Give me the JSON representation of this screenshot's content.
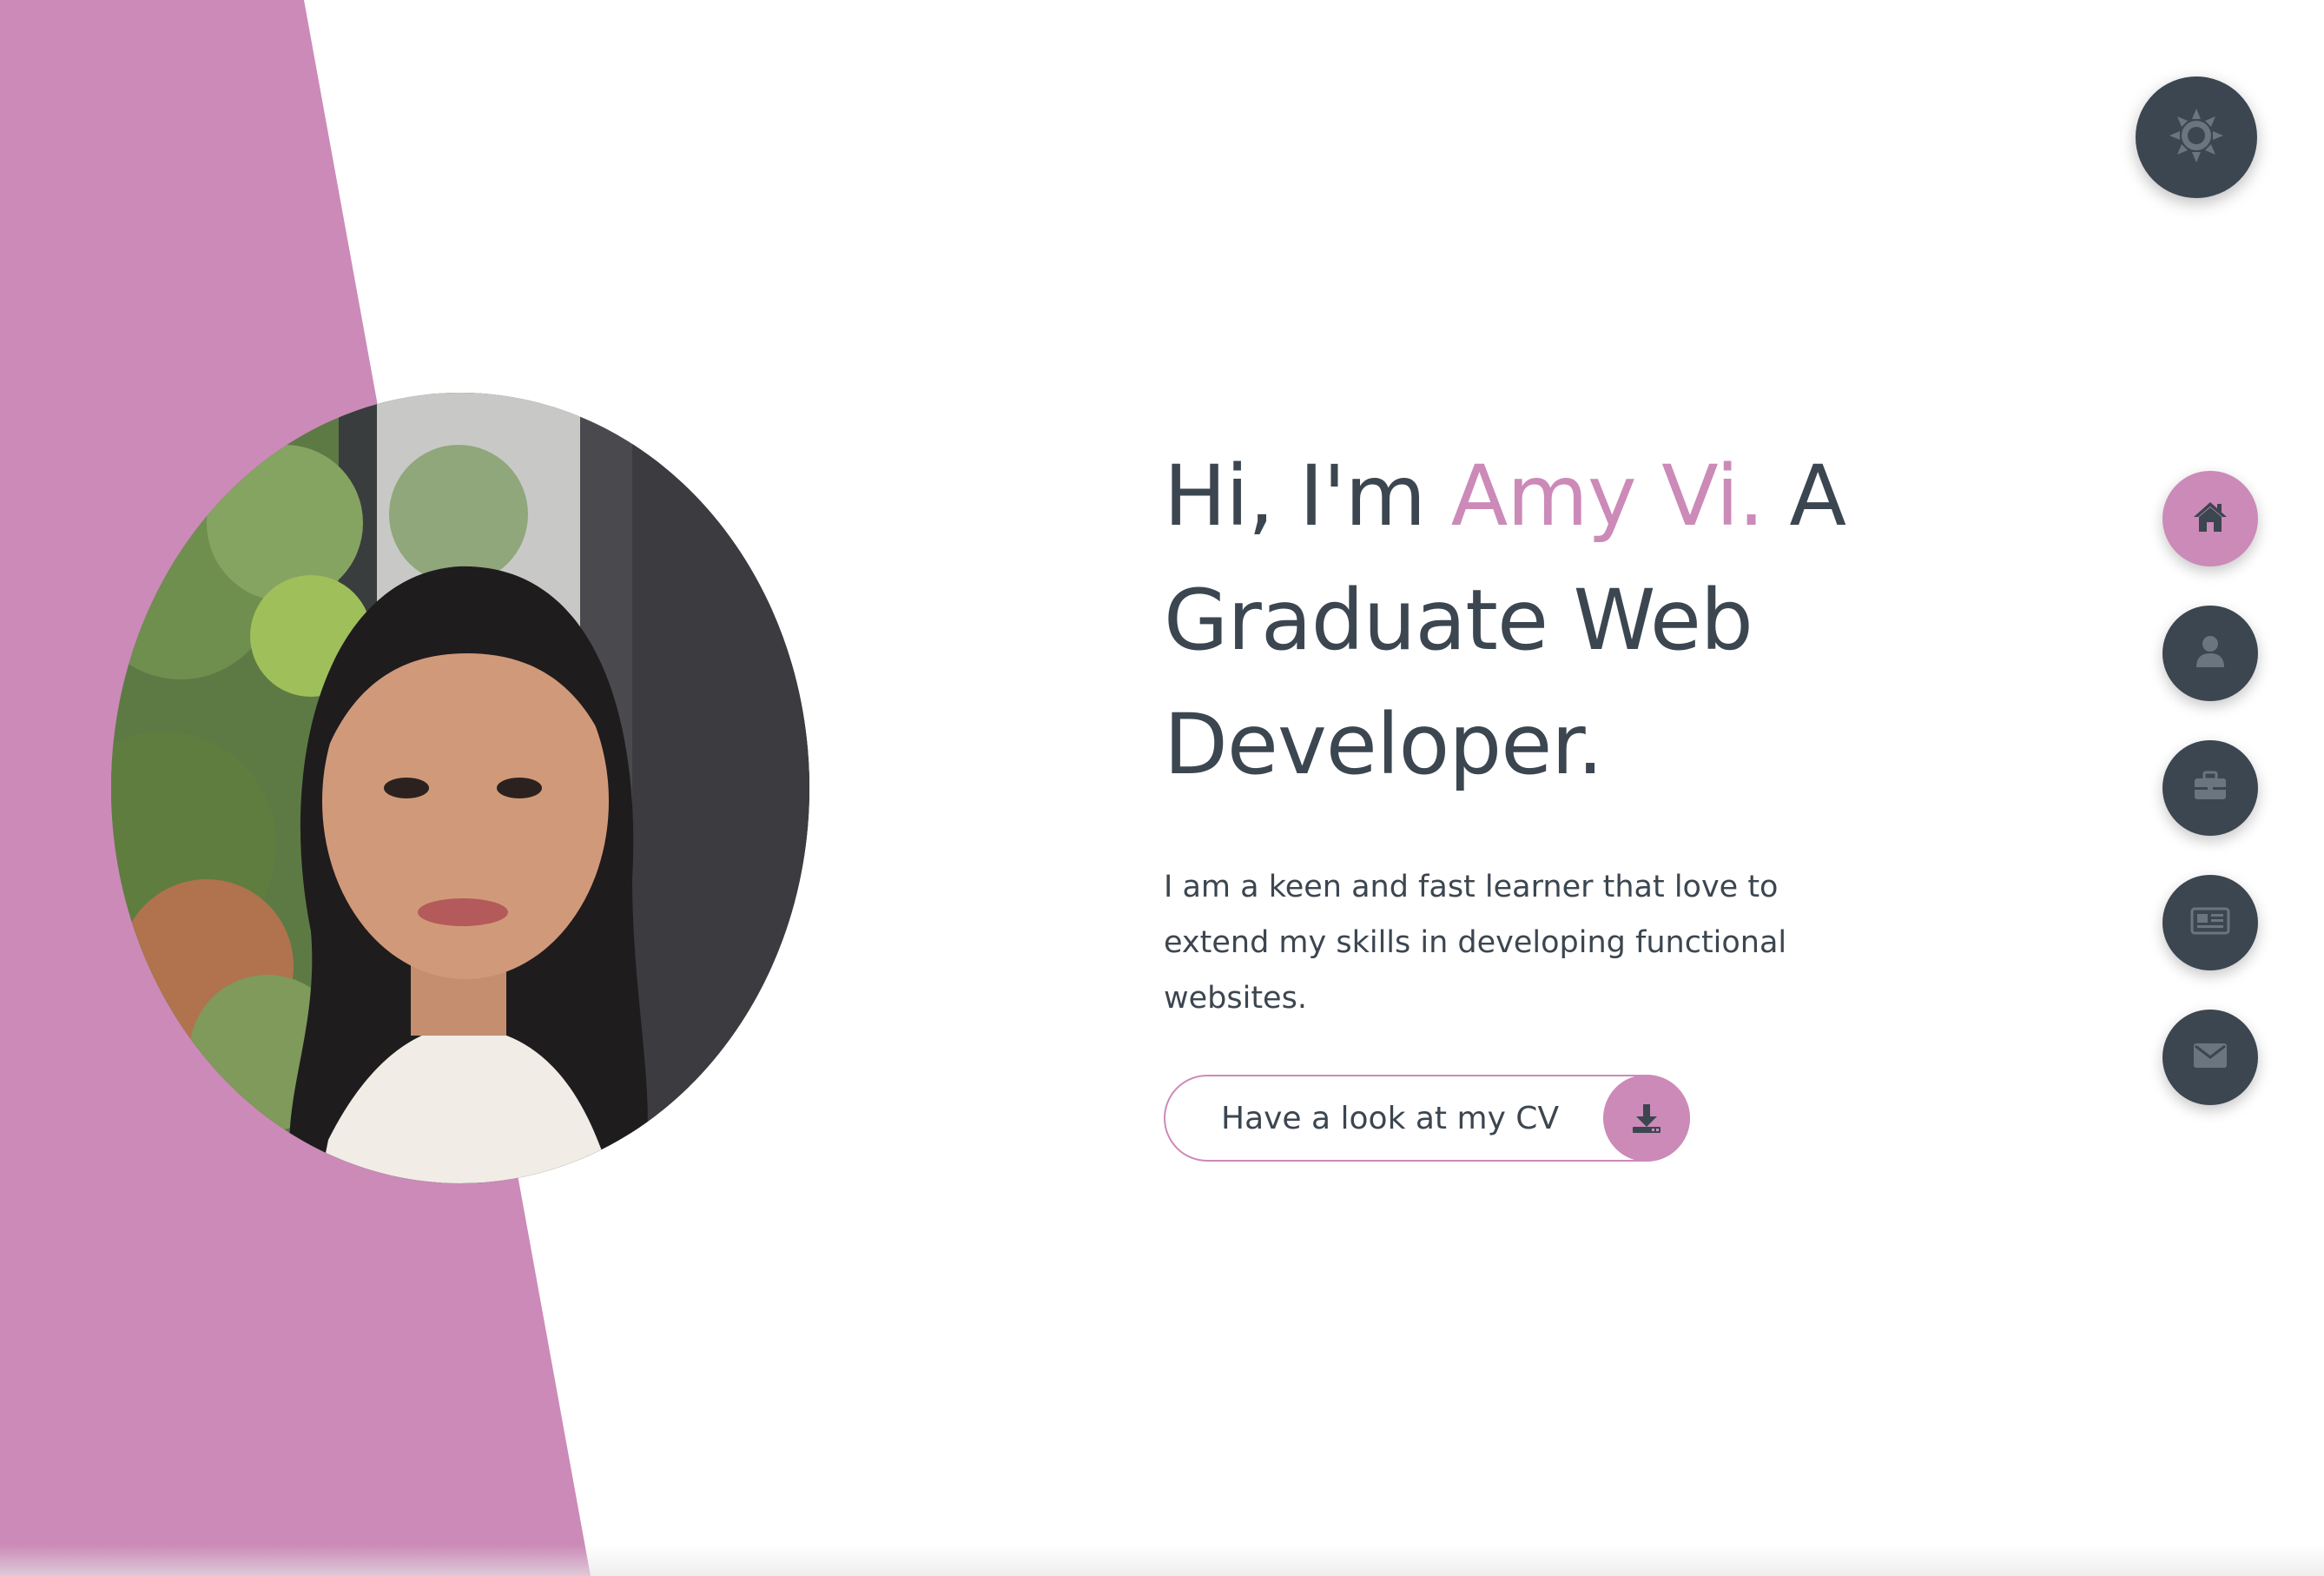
{
  "colors": {
    "accent": "#cc8ab8",
    "dark": "#3c4650",
    "background": "#ffffff"
  },
  "hero": {
    "title_prefix": "Hi, I'm ",
    "title_name": "Amy Vi.",
    "title_suffix": " A Graduate Web Developer.",
    "description": "I am a keen and fast learner that love to extend my skills in developing functional websites.",
    "cv_button_label": "Have a look at my CV",
    "cv_button_icon": "download-icon"
  },
  "theme_toggle": {
    "icon": "sun-icon"
  },
  "nav": {
    "items": [
      {
        "id": "home",
        "icon": "home-icon",
        "active": true
      },
      {
        "id": "about",
        "icon": "user-icon",
        "active": false
      },
      {
        "id": "portfolio",
        "icon": "briefcase-icon",
        "active": false
      },
      {
        "id": "blogs",
        "icon": "newspaper-icon",
        "active": false
      },
      {
        "id": "contact",
        "icon": "envelope-icon",
        "active": false
      }
    ]
  },
  "portrait": {
    "subject": "profile-photo"
  }
}
